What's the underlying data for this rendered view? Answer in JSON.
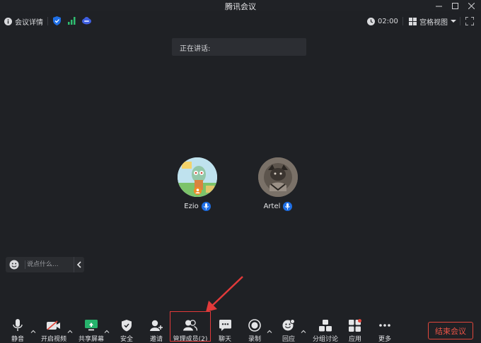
{
  "window": {
    "title": "腾讯会议"
  },
  "topbar": {
    "meeting_details": "会议详情",
    "timer": "02:00",
    "view_mode": "宫格视图"
  },
  "speaking": {
    "label": "正在讲话:"
  },
  "participants": [
    {
      "name": "Ezio",
      "is_host": true,
      "mic": "mic-on-icon"
    },
    {
      "name": "Artel",
      "is_host": false,
      "mic": "mic-on-icon"
    }
  ],
  "chat": {
    "placeholder": "说点什么..."
  },
  "toolbar": {
    "items": [
      {
        "label": "静音",
        "icon": "microphone-icon"
      },
      {
        "label": "开启视频",
        "icon": "video-off-icon"
      },
      {
        "label": "共享屏幕",
        "icon": "share-screen-icon"
      },
      {
        "label": "安全",
        "icon": "shield-icon"
      },
      {
        "label": "邀请",
        "icon": "invite-icon"
      },
      {
        "label": "管理成员(2)",
        "icon": "members-icon"
      },
      {
        "label": "聊天",
        "icon": "chat-icon"
      },
      {
        "label": "录制",
        "icon": "record-icon"
      },
      {
        "label": "回应",
        "icon": "reaction-icon"
      },
      {
        "label": "分组讨论",
        "icon": "breakout-icon"
      },
      {
        "label": "应用",
        "icon": "apps-icon"
      },
      {
        "label": "更多",
        "icon": "more-icon"
      }
    ],
    "end_meeting": "结束会议"
  },
  "colors": {
    "background": "#1f2125",
    "accent_blue": "#1f6fe5",
    "end_red": "#e2473c",
    "share_green": "#27b36c",
    "signal_green": "#2fbf71"
  }
}
